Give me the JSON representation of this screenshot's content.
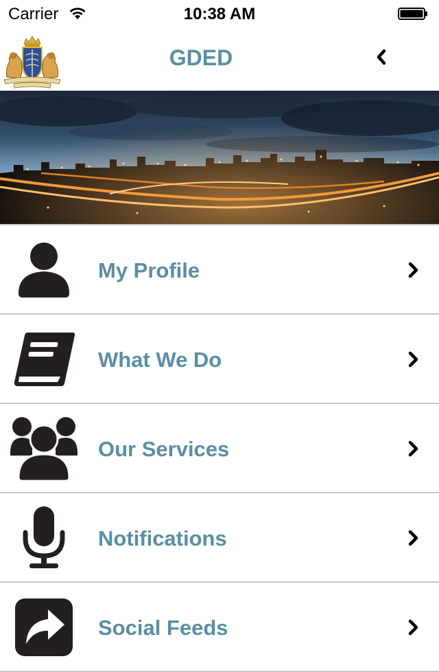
{
  "status_bar": {
    "carrier": "Carrier",
    "time": "10:38 AM"
  },
  "header": {
    "title": "GDED",
    "logo": "coat-of-arms-logo",
    "back_icon": "chevron-left-icon"
  },
  "banner": {
    "image": "city-skyline-at-dusk"
  },
  "menu": {
    "items": [
      {
        "label": "My Profile",
        "icon": "user-icon"
      },
      {
        "label": "What We Do",
        "icon": "book-icon"
      },
      {
        "label": "Our Services",
        "icon": "group-icon"
      },
      {
        "label": "Notifications",
        "icon": "microphone-icon"
      },
      {
        "label": "Social Feeds",
        "icon": "share-icon"
      }
    ]
  },
  "colors": {
    "accent": "#5a8ea4",
    "icon": "#231f20",
    "divider": "#c8c8c8"
  }
}
